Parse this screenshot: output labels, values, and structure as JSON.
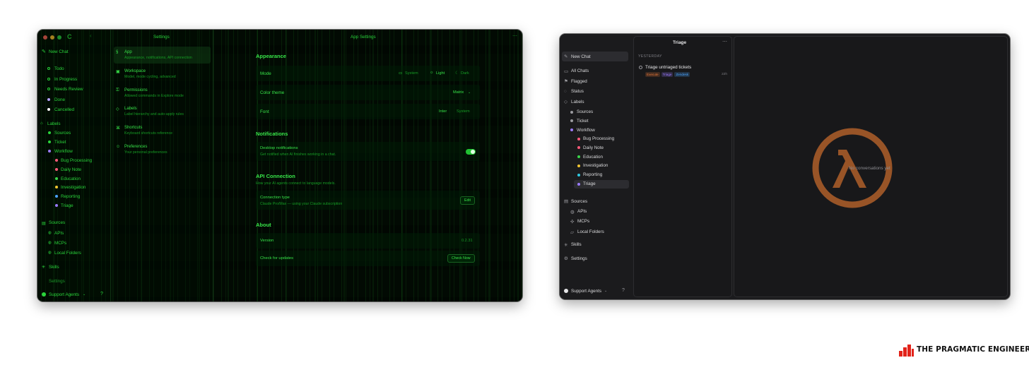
{
  "left_window": {
    "sidebar": {
      "new_chat": "New Chat",
      "status_items": [
        {
          "label": "Todo",
          "color": "#2ad43b"
        },
        {
          "label": "In Progress",
          "color": "#2ad43b"
        },
        {
          "label": "Needs Review",
          "color": "#2ad43b"
        },
        {
          "label": "Done",
          "color": "#b6a3ff"
        },
        {
          "label": "Cancelled",
          "color": "#ffffff"
        }
      ],
      "labels_header": "Labels",
      "labels": [
        {
          "label": "Sources",
          "color": "#2ad43b"
        },
        {
          "label": "Ticket",
          "color": "#2ad43b"
        },
        {
          "label": "Workflow",
          "color": "#9b7bff"
        }
      ],
      "workflow_children": [
        {
          "label": "Bug Processing",
          "color": "#ff5a7a"
        },
        {
          "label": "Daily Note",
          "color": "#ff5a7a"
        },
        {
          "label": "Education",
          "color": "#3ad54a"
        },
        {
          "label": "Investigation",
          "color": "#f3c530"
        },
        {
          "label": "Reporting",
          "color": "#4aa3ff"
        },
        {
          "label": "Triage",
          "color": "#9b7bff"
        }
      ],
      "sources_header": "Sources",
      "source_items": [
        "APIs",
        "MCPs",
        "Local Folders"
      ],
      "skills": "Skills",
      "settings": "Settings",
      "workspace": "Support Agents"
    },
    "settings_panel": {
      "title": "Settings",
      "items": [
        {
          "title": "App",
          "desc": "Appearance, notifications, API connection"
        },
        {
          "title": "Workspace",
          "desc": "Model, mode cycling, advanced"
        },
        {
          "title": "Permissions",
          "desc": "Allowed commands in Explore mode"
        },
        {
          "title": "Labels",
          "desc": "Label hierarchy and auto-apply rules"
        },
        {
          "title": "Shortcuts",
          "desc": "Keyboard shortcuts reference"
        },
        {
          "title": "Preferences",
          "desc": "Your personal preferences"
        }
      ]
    },
    "main": {
      "title": "App Settings",
      "appearance_header": "Appearance",
      "mode_label": "Mode",
      "mode_options": [
        "System",
        "Light",
        "Dark"
      ],
      "color_theme_label": "Color theme",
      "color_theme_value": "Matrix",
      "font_label": "Font",
      "font_options": [
        "Inter",
        "System"
      ],
      "notifications_header": "Notifications",
      "desktop_notifications_label": "Desktop notifications",
      "desktop_notifications_desc": "Get notified when AI finishes working in a chat.",
      "desktop_notifications_on": true,
      "api_header": "API Connection",
      "api_desc": "How your AI agents connect to language models.",
      "connection_type_label": "Connection type",
      "connection_type_desc": "Claude Pro/Max — using your Claude subscription",
      "edit_button": "Edit",
      "about_header": "About",
      "version_label": "Version",
      "version_value": "0.2.31",
      "check_updates_label": "Check for updates",
      "check_now_button": "Check Now"
    }
  },
  "right_window": {
    "sidebar": {
      "new_chat": "New Chat",
      "nav": [
        "All Chats",
        "Flagged",
        "Status",
        "Labels"
      ],
      "labels": [
        {
          "label": "Sources",
          "color": "#9b9ba0"
        },
        {
          "label": "Ticket",
          "color": "#9b9ba0"
        },
        {
          "label": "Workflow",
          "color": "#9b7bff"
        }
      ],
      "workflow_children": [
        {
          "label": "Bug Processing",
          "color": "#ff5a7a"
        },
        {
          "label": "Daily Note",
          "color": "#ff5a7a"
        },
        {
          "label": "Education",
          "color": "#3ad54a"
        },
        {
          "label": "Investigation",
          "color": "#f3c530"
        },
        {
          "label": "Reporting",
          "color": "#2ec8e0"
        },
        {
          "label": "Triage",
          "color": "#9b7bff"
        }
      ],
      "sources_header": "Sources",
      "source_items": [
        "APIs",
        "MCPs",
        "Local Folders"
      ],
      "skills": "Skills",
      "settings": "Settings",
      "workspace": "Support Agents"
    },
    "list": {
      "title": "Triage",
      "group": "YESTERDAY",
      "item_title": "Triage untriaged tickets",
      "tags": [
        {
          "label": "Execute",
          "color": "#e8783a"
        },
        {
          "label": "Triage",
          "color": "#9b7bff"
        },
        {
          "label": "Zendesk",
          "color": "#4aa3ff"
        }
      ],
      "item_time": "22h"
    },
    "empty_state": "No conversations yet",
    "watermark_color": "#b4612b"
  },
  "brand": {
    "name": "THE PRAGMATIC ENGINEER",
    "accent": "#e2231a"
  }
}
